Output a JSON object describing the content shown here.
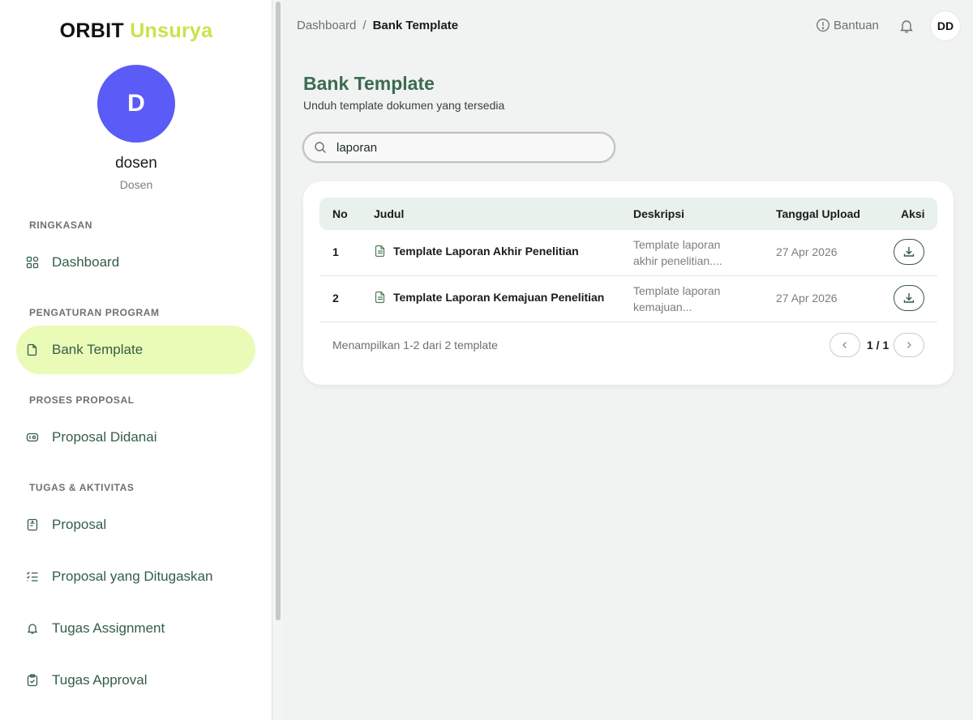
{
  "brand": {
    "part1": "ORBIT",
    "part2": "Unsurya"
  },
  "user": {
    "initial": "D",
    "name": "dosen",
    "role": "Dosen",
    "avatar_initials": "DD"
  },
  "sidebar": {
    "sections": [
      {
        "label": "RINGKASAN"
      },
      {
        "label": "PENGATURAN PROGRAM"
      },
      {
        "label": "PROSES PROPOSAL"
      },
      {
        "label": "TUGAS & AKTIVITAS"
      }
    ],
    "items": [
      {
        "label": "Dashboard",
        "icon": "grid-icon"
      },
      {
        "label": "Bank Template",
        "icon": "file-icon",
        "active": true
      },
      {
        "label": "Proposal Didanai",
        "icon": "money-icon"
      },
      {
        "label": "Proposal",
        "icon": "document-icon"
      },
      {
        "label": "Proposal yang Ditugaskan",
        "icon": "checklist-icon"
      },
      {
        "label": "Tugas Assignment",
        "icon": "bell-icon"
      },
      {
        "label": "Tugas Approval",
        "icon": "clipboard-check-icon"
      }
    ]
  },
  "header": {
    "breadcrumb": [
      "Dashboard",
      "Bank Template"
    ],
    "help_label": "Bantuan"
  },
  "page": {
    "title": "Bank Template",
    "subtitle": "Unduh template dokumen yang tersedia"
  },
  "search": {
    "value": "laporan",
    "placeholder": ""
  },
  "table": {
    "columns": [
      "No",
      "Judul",
      "Deskripsi",
      "Tanggal Upload",
      "Aksi"
    ],
    "rows": [
      {
        "no": "1",
        "title": "Template Laporan Akhir Penelitian",
        "desc1": "Template laporan",
        "desc2": "akhir penelitian....",
        "date": "27 Apr 2026"
      },
      {
        "no": "2",
        "title": "Template Laporan Kemajuan Penelitian",
        "desc1": "Template laporan",
        "desc2": "kemajuan...",
        "date": "27 Apr 2026"
      }
    ],
    "footer": "Menampilkan 1-2 dari 2 template",
    "pagination": "1 / 1"
  },
  "colors": {
    "accent": "#cbe24a",
    "active_bg": "#eafab7",
    "primary_text": "#3d6b50",
    "avatar": "#5b5bf7"
  }
}
